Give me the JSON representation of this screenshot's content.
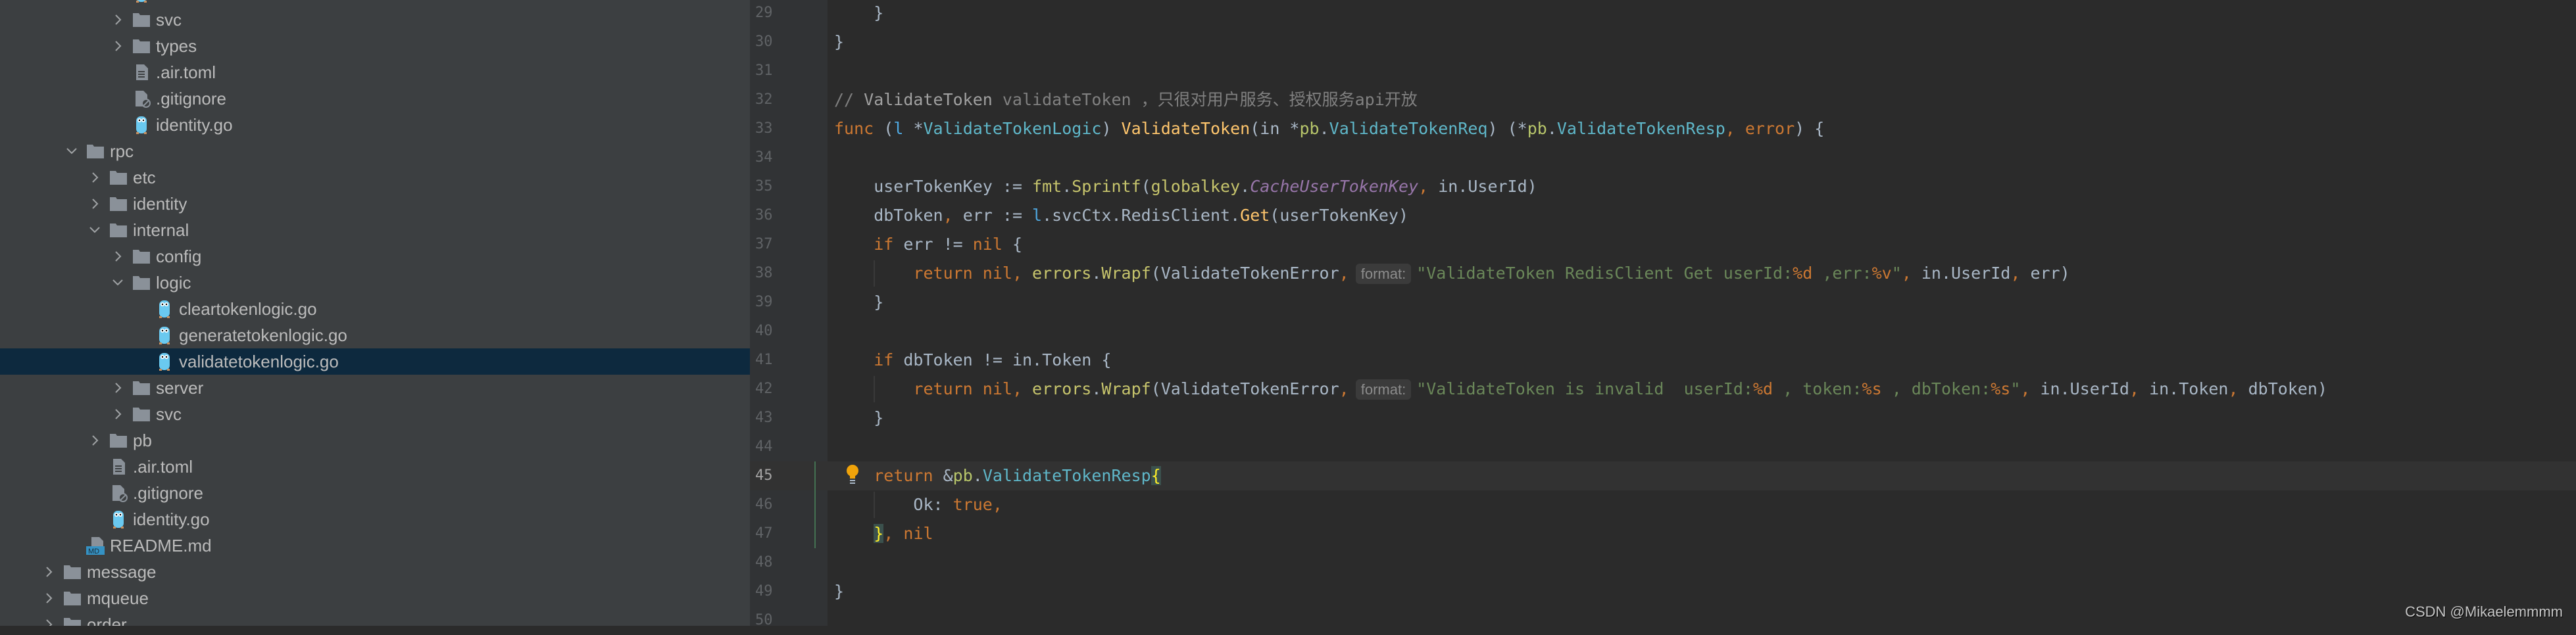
{
  "colors": {
    "sidebar_bg": "#3c3f41",
    "editor_bg": "#2b2b2b",
    "selection": "#0d293e",
    "go_icon": "#6ac9f0",
    "folder_icon": "#8a9199"
  },
  "tree": [
    {
      "label": "",
      "level": 3,
      "kind": "go",
      "partial": true
    },
    {
      "label": "svc",
      "level": 3,
      "kind": "folder",
      "expanded": false
    },
    {
      "label": "types",
      "level": 3,
      "kind": "folder",
      "expanded": false
    },
    {
      "label": ".air.toml",
      "level": 3,
      "kind": "text"
    },
    {
      "label": ".gitignore",
      "level": 3,
      "kind": "ignore"
    },
    {
      "label": "identity.go",
      "level": 3,
      "kind": "go"
    },
    {
      "label": "rpc",
      "level": 1,
      "kind": "folder",
      "expanded": true
    },
    {
      "label": "etc",
      "level": 2,
      "kind": "folder",
      "expanded": false
    },
    {
      "label": "identity",
      "level": 2,
      "kind": "folder",
      "expanded": false
    },
    {
      "label": "internal",
      "level": 2,
      "kind": "folder",
      "expanded": true
    },
    {
      "label": "config",
      "level": 3,
      "kind": "folder",
      "expanded": false
    },
    {
      "label": "logic",
      "level": 3,
      "kind": "folder",
      "expanded": true
    },
    {
      "label": "cleartokenlogic.go",
      "level": 4,
      "kind": "go"
    },
    {
      "label": "generatetokenlogic.go",
      "level": 4,
      "kind": "go"
    },
    {
      "label": "validatetokenlogic.go",
      "level": 4,
      "kind": "go",
      "selected": true
    },
    {
      "label": "server",
      "level": 3,
      "kind": "folder",
      "expanded": false
    },
    {
      "label": "svc",
      "level": 3,
      "kind": "folder",
      "expanded": false
    },
    {
      "label": "pb",
      "level": 2,
      "kind": "folder",
      "expanded": false
    },
    {
      "label": ".air.toml",
      "level": 2,
      "kind": "text"
    },
    {
      "label": ".gitignore",
      "level": 2,
      "kind": "ignore"
    },
    {
      "label": "identity.go",
      "level": 2,
      "kind": "go"
    },
    {
      "label": "README.md",
      "level": 1,
      "kind": "md",
      "md_badge": "MD"
    },
    {
      "label": "message",
      "level": 0,
      "kind": "folder",
      "expanded": false
    },
    {
      "label": "mqueue",
      "level": 0,
      "kind": "folder",
      "expanded": false
    },
    {
      "label": "order",
      "level": 0,
      "kind": "folder",
      "expanded": false
    }
  ],
  "editor": {
    "current_line": 45,
    "lines": [
      {
        "n": 29,
        "t": [
          [
            "p",
            "    }"
          ]
        ]
      },
      {
        "n": 30,
        "t": [
          [
            "p",
            "}"
          ]
        ]
      },
      {
        "n": 31,
        "t": []
      },
      {
        "n": 32,
        "t": [
          [
            "com",
            "// "
          ],
          [
            "comb",
            "ValidateToken"
          ],
          [
            "com",
            " validateToken ，只很对用户服务、授权服务api开放"
          ]
        ]
      },
      {
        "n": 33,
        "t": [
          [
            "kw",
            "func"
          ],
          [
            "p",
            " ("
          ],
          [
            "recv",
            "l"
          ],
          [
            "p",
            " *"
          ],
          [
            "type",
            "ValidateTokenLogic"
          ],
          [
            "p",
            ") "
          ],
          [
            "fn",
            "ValidateToken"
          ],
          [
            "p",
            "(in *"
          ],
          [
            "pkg",
            "pb"
          ],
          [
            "p",
            "."
          ],
          [
            "type",
            "ValidateTokenReq"
          ],
          [
            "p",
            ") (*"
          ],
          [
            "pkg",
            "pb"
          ],
          [
            "p",
            "."
          ],
          [
            "type",
            "ValidateTokenResp"
          ],
          [
            "punc",
            ", "
          ],
          [
            "kw",
            "error"
          ],
          [
            "p",
            ") {"
          ]
        ]
      },
      {
        "n": 34,
        "t": []
      },
      {
        "n": 35,
        "t": [
          [
            "p",
            "    userTokenKey := "
          ],
          [
            "call",
            "fmt"
          ],
          [
            "p",
            "."
          ],
          [
            "call",
            "Sprintf"
          ],
          [
            "p",
            "("
          ],
          [
            "call",
            "globalkey"
          ],
          [
            "p",
            "."
          ],
          [
            "const",
            "CacheUserTokenKey"
          ],
          [
            "punc",
            ", "
          ],
          [
            "p",
            "in.UserId)"
          ]
        ]
      },
      {
        "n": 36,
        "t": [
          [
            "p",
            "    dbToken"
          ],
          [
            "punc",
            ", "
          ],
          [
            "p",
            "err := "
          ],
          [
            "recv",
            "l"
          ],
          [
            "p",
            ".svcCtx.RedisClient."
          ],
          [
            "fn",
            "Get"
          ],
          [
            "p",
            "(userTokenKey)"
          ]
        ]
      },
      {
        "n": 37,
        "t": [
          [
            "p",
            "    "
          ],
          [
            "kw",
            "if"
          ],
          [
            "p",
            " err != "
          ],
          [
            "kw",
            "nil"
          ],
          [
            "p",
            " {"
          ]
        ]
      },
      {
        "n": 38,
        "t": [
          [
            "p",
            "        "
          ],
          [
            "kw",
            "return nil"
          ],
          [
            "punc",
            ", "
          ],
          [
            "call",
            "errors"
          ],
          [
            "p",
            "."
          ],
          [
            "call",
            "Wrapf"
          ],
          [
            "p",
            "(ValidateTokenError"
          ],
          [
            "punc",
            ","
          ],
          [
            "hint",
            "format:"
          ],
          [
            "str",
            "\"ValidateToken RedisClient Get userId:"
          ],
          [
            "fmt",
            "%d"
          ],
          [
            "str",
            " ,err:"
          ],
          [
            "fmt",
            "%v"
          ],
          [
            "str",
            "\""
          ],
          [
            "punc",
            ", "
          ],
          [
            "p",
            "in.UserId"
          ],
          [
            "punc",
            ", "
          ],
          [
            "p",
            "err)"
          ]
        ]
      },
      {
        "n": 39,
        "t": [
          [
            "p",
            "    }"
          ]
        ]
      },
      {
        "n": 40,
        "t": []
      },
      {
        "n": 41,
        "t": [
          [
            "p",
            "    "
          ],
          [
            "kw",
            "if"
          ],
          [
            "p",
            " dbToken != in.Token {"
          ]
        ]
      },
      {
        "n": 42,
        "t": [
          [
            "p",
            "        "
          ],
          [
            "kw",
            "return nil"
          ],
          [
            "punc",
            ", "
          ],
          [
            "call",
            "errors"
          ],
          [
            "p",
            "."
          ],
          [
            "call",
            "Wrapf"
          ],
          [
            "p",
            "(ValidateTokenError"
          ],
          [
            "punc",
            ","
          ],
          [
            "hint",
            "format:"
          ],
          [
            "str",
            "\"ValidateToken is invalid  userId:"
          ],
          [
            "fmt",
            "%d"
          ],
          [
            "str",
            " , token:"
          ],
          [
            "fmt",
            "%s"
          ],
          [
            "str",
            " , dbToken:"
          ],
          [
            "fmt",
            "%s"
          ],
          [
            "str",
            "\""
          ],
          [
            "punc",
            ", "
          ],
          [
            "p",
            "in.UserId"
          ],
          [
            "punc",
            ", "
          ],
          [
            "p",
            "in.Token"
          ],
          [
            "punc",
            ", "
          ],
          [
            "p",
            "dbToken)"
          ]
        ]
      },
      {
        "n": 43,
        "t": [
          [
            "p",
            "    }"
          ]
        ]
      },
      {
        "n": 44,
        "t": []
      },
      {
        "n": 45,
        "t": [
          [
            "p",
            "    "
          ],
          [
            "kw",
            "return"
          ],
          [
            "p",
            " &"
          ],
          [
            "pkg",
            "pb"
          ],
          [
            "p",
            "."
          ],
          [
            "type",
            "ValidateTokenResp"
          ],
          [
            "brace",
            "{"
          ]
        ]
      },
      {
        "n": 46,
        "t": [
          [
            "p",
            "        Ok: "
          ],
          [
            "kw",
            "true"
          ],
          [
            "punc",
            ","
          ]
        ]
      },
      {
        "n": 47,
        "t": [
          [
            "p",
            "    "
          ],
          [
            "brace",
            "}"
          ],
          [
            "punc",
            ", "
          ],
          [
            "kw",
            "nil"
          ]
        ]
      },
      {
        "n": 48,
        "t": []
      },
      {
        "n": 49,
        "t": [
          [
            "p",
            "}"
          ]
        ]
      },
      {
        "n": 50,
        "t": []
      }
    ]
  },
  "watermark": "CSDN @Mikaelemmmm"
}
